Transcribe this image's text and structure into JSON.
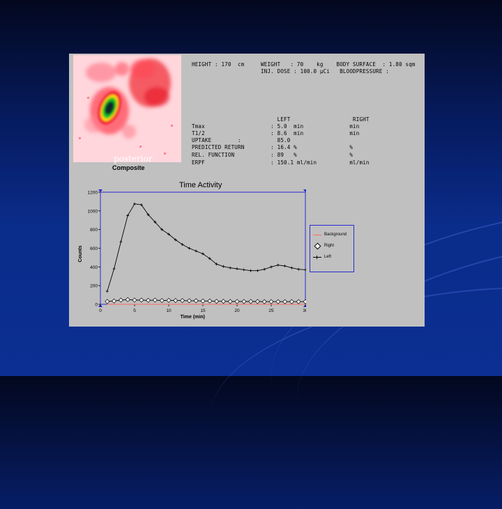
{
  "scan": {
    "label": "posterior",
    "caption": "Composite"
  },
  "header": {
    "line1": "HEIGHT : 170  cm     WEIGHT   : 70    kg    BODY SURFACE  : 1.80 sqm",
    "line2": "                     INJ. DOSE : 100.0 µCi   BLOODPRESSURE :"
  },
  "results": {
    "col_header": "                          LEFT                   RIGHT",
    "rows": [
      "Tmax                    : 5.0  min              min",
      "T1/2                    : 8.6  min              min",
      "UPTAKE        :           85.0",
      "PREDICTED RETURN        : 16.4 %                %",
      "REL. FUNCTION           : 89   %                %",
      "ERPF                    : 150.1 ml/min          ml/min"
    ]
  },
  "chart_data": {
    "type": "line",
    "title": "Time Activity",
    "xlabel": "Time (min)",
    "ylabel": "Counts",
    "xlim": [
      0,
      30
    ],
    "ylim": [
      0,
      1200
    ],
    "xticks": [
      0,
      5,
      10,
      15,
      20,
      25,
      30
    ],
    "yticks": [
      0,
      200,
      400,
      600,
      800,
      1000,
      1200
    ],
    "legend_position": "right",
    "series": [
      {
        "name": "Background",
        "color": "#ff6a5a",
        "marker": "none",
        "x": [
          1,
          30
        ],
        "y": [
          0,
          0
        ]
      },
      {
        "name": "Right",
        "color": "#000000",
        "marker": "diamond",
        "x": [
          1,
          2,
          3,
          4,
          5,
          6,
          7,
          8,
          9,
          10,
          11,
          12,
          13,
          14,
          15,
          16,
          17,
          18,
          19,
          20,
          21,
          22,
          23,
          24,
          25,
          26,
          27,
          28,
          29,
          30
        ],
        "y": [
          30,
          35,
          45,
          50,
          45,
          45,
          42,
          45,
          40,
          42,
          40,
          40,
          38,
          38,
          35,
          35,
          32,
          32,
          30,
          30,
          30,
          30,
          30,
          28,
          28,
          28,
          28,
          28,
          28,
          28
        ]
      },
      {
        "name": "Left",
        "color": "#000000",
        "marker": "plus",
        "x": [
          1,
          2,
          3,
          4,
          5,
          6,
          7,
          8,
          9,
          10,
          11,
          12,
          13,
          14,
          15,
          16,
          17,
          18,
          19,
          20,
          21,
          22,
          23,
          24,
          25,
          26,
          27,
          28,
          29,
          30
        ],
        "y": [
          140,
          380,
          670,
          950,
          1075,
          1065,
          960,
          880,
          800,
          750,
          690,
          640,
          600,
          570,
          540,
          490,
          430,
          405,
          390,
          380,
          370,
          360,
          360,
          375,
          400,
          420,
          410,
          390,
          375,
          370
        ]
      }
    ]
  },
  "colors": {
    "panel": "#c0c0c0",
    "axis": "#2a2ad0",
    "scan_background": "#ffd6dc"
  }
}
